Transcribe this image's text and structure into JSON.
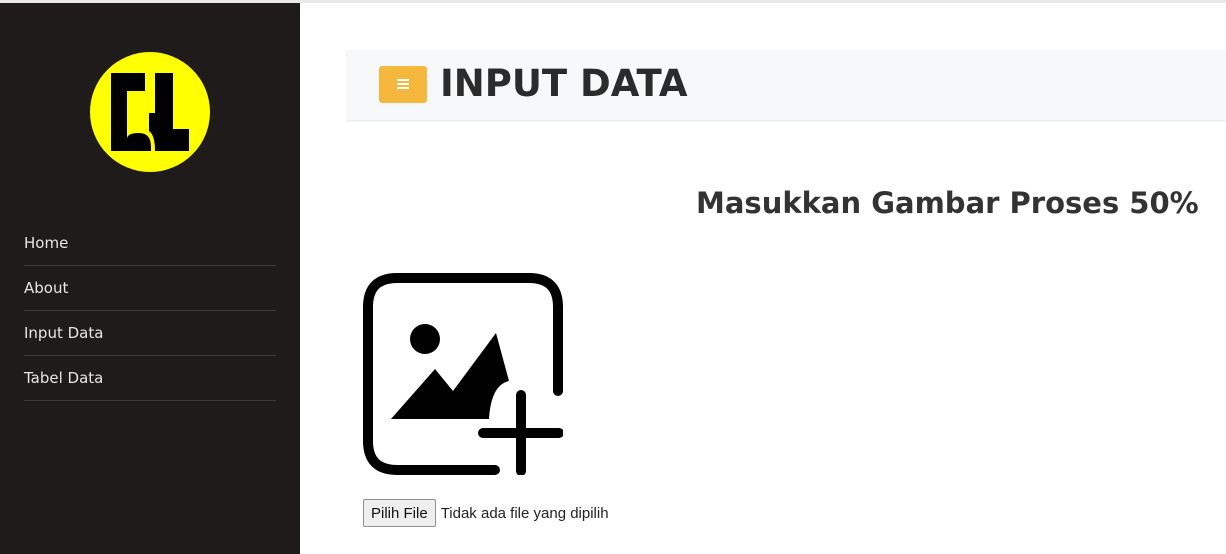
{
  "sidebar": {
    "logo_icon": "pu-logo-icon",
    "logo_color": "#ffff00",
    "items": [
      {
        "label": "Home"
      },
      {
        "label": "About"
      },
      {
        "label": "Input Data"
      },
      {
        "label": "Tabel Data"
      }
    ]
  },
  "header": {
    "menu_icon": "hamburger-icon",
    "accent_color": "#f5b73c",
    "title": "INPUT DATA"
  },
  "main": {
    "subtitle": "Masukkan Gambar Proses 50%",
    "image_placeholder_icon": "add-image-icon",
    "file_input": {
      "button_label": "Pilih File",
      "status_text": "Tidak ada file yang dipilih"
    }
  }
}
